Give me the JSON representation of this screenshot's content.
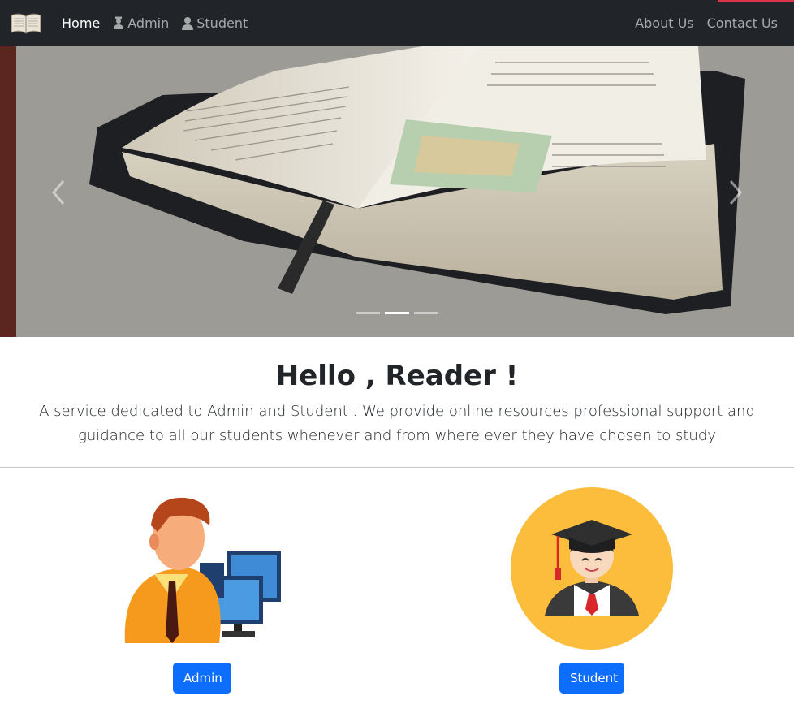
{
  "navbar": {
    "brand_icon": "open-book-icon",
    "left_links": [
      {
        "label": "Home",
        "icon": "",
        "active": true
      },
      {
        "label": "Admin",
        "icon": "admin-user-icon",
        "active": false
      },
      {
        "label": "Student",
        "icon": "user-icon",
        "active": false
      }
    ],
    "right_links": [
      {
        "label": "About Us"
      },
      {
        "label": "Contact Us"
      }
    ],
    "background_color": "#212529",
    "accent_color": "#dc3545"
  },
  "carousel": {
    "slide_count": 3,
    "active_slide": 2,
    "prev_icon": "chevron-left-icon",
    "next_icon": "chevron-right-icon"
  },
  "hero": {
    "title": "Hello , Reader !",
    "description": "A service dedicated to Admin and Student . We provide online resources professional support and guidance to all our students whenever and from where ever they have chosen to study"
  },
  "roles": {
    "admin": {
      "button_label": "Admin",
      "image_icon": "admin-computer-icon"
    },
    "student": {
      "button_label": "Student",
      "image_icon": "graduate-student-icon"
    }
  },
  "colors": {
    "primary": "#0d6efd",
    "student_circle": "#fbbd3b"
  }
}
